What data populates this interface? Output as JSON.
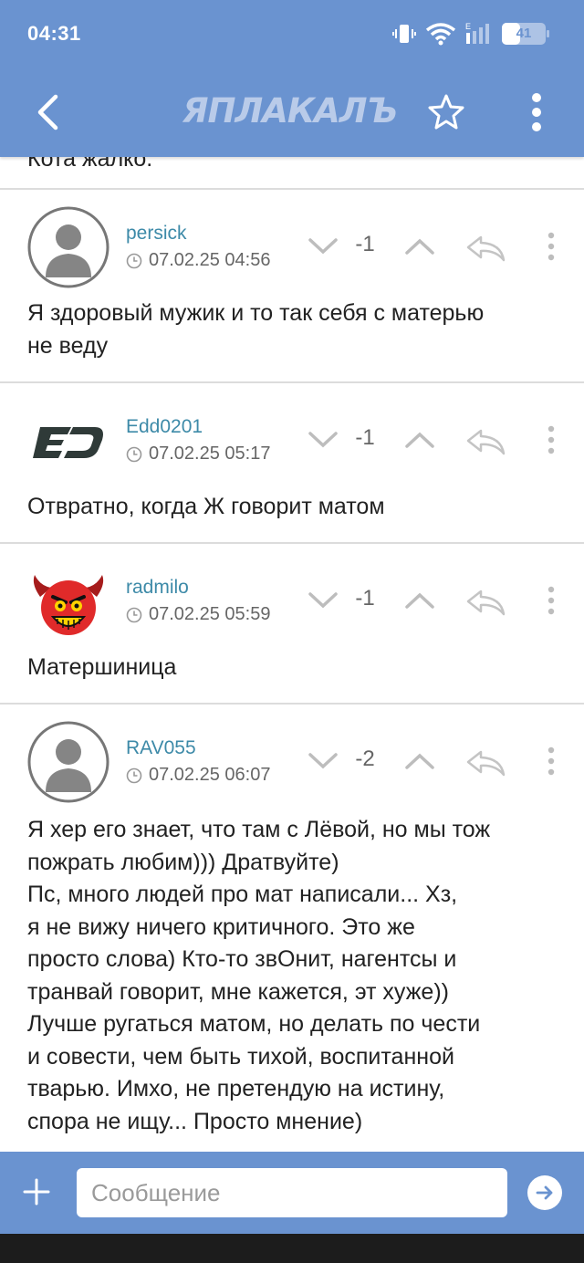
{
  "status_bar": {
    "time": "04:31",
    "battery_level": "41",
    "battery_fraction": 0.41,
    "network_label": "E"
  },
  "app_bar": {
    "logo_text": "ЯПЛАКАЛЪ"
  },
  "partial_post": {
    "text": "Кота жалко."
  },
  "posts": [
    {
      "username": "persick",
      "date": "07.02.25 04:56",
      "votes": "-1",
      "avatar": "default-avatar-icon",
      "text": "Я здоровый мужик и то так себя с матерью\nне веду"
    },
    {
      "username": "Edd0201",
      "date": "07.02.25 05:17",
      "votes": "-1",
      "avatar": "ed-logo-avatar",
      "text": "Отвратно, когда Ж говорит матом"
    },
    {
      "username": "radmilo",
      "date": "07.02.25 05:59",
      "votes": "-1",
      "avatar": "devil-smiley-avatar",
      "text": "Матершиница"
    },
    {
      "username": "RAV055",
      "date": "07.02.25 06:07",
      "votes": "-2",
      "avatar": "default-avatar-icon",
      "text": "Я хер его знает, что там с Лёвой, но мы тож\nпожрать любим))) Дратвуйте)\nПс, много людей про мат написали... Хз,\nя не вижу ничего критичного. Это же\nпросто слова) Кто-то звОнит, нагентсы и\nтранвай говорит, мне кажется, эт хуже))\nЛучше ругаться матом, но делать по чести\nи совести, чем быть тихой, воспитанной\nтварью. Имхо, не претендую на истину,\nспора не ищу... Просто мнение)"
    }
  ],
  "composer": {
    "placeholder": "Сообщение",
    "value": ""
  },
  "colors": {
    "header": "#6a93d0",
    "username": "#3d8aa8",
    "divider": "#dcdcdc",
    "icon_gray": "#bdbdbd"
  }
}
